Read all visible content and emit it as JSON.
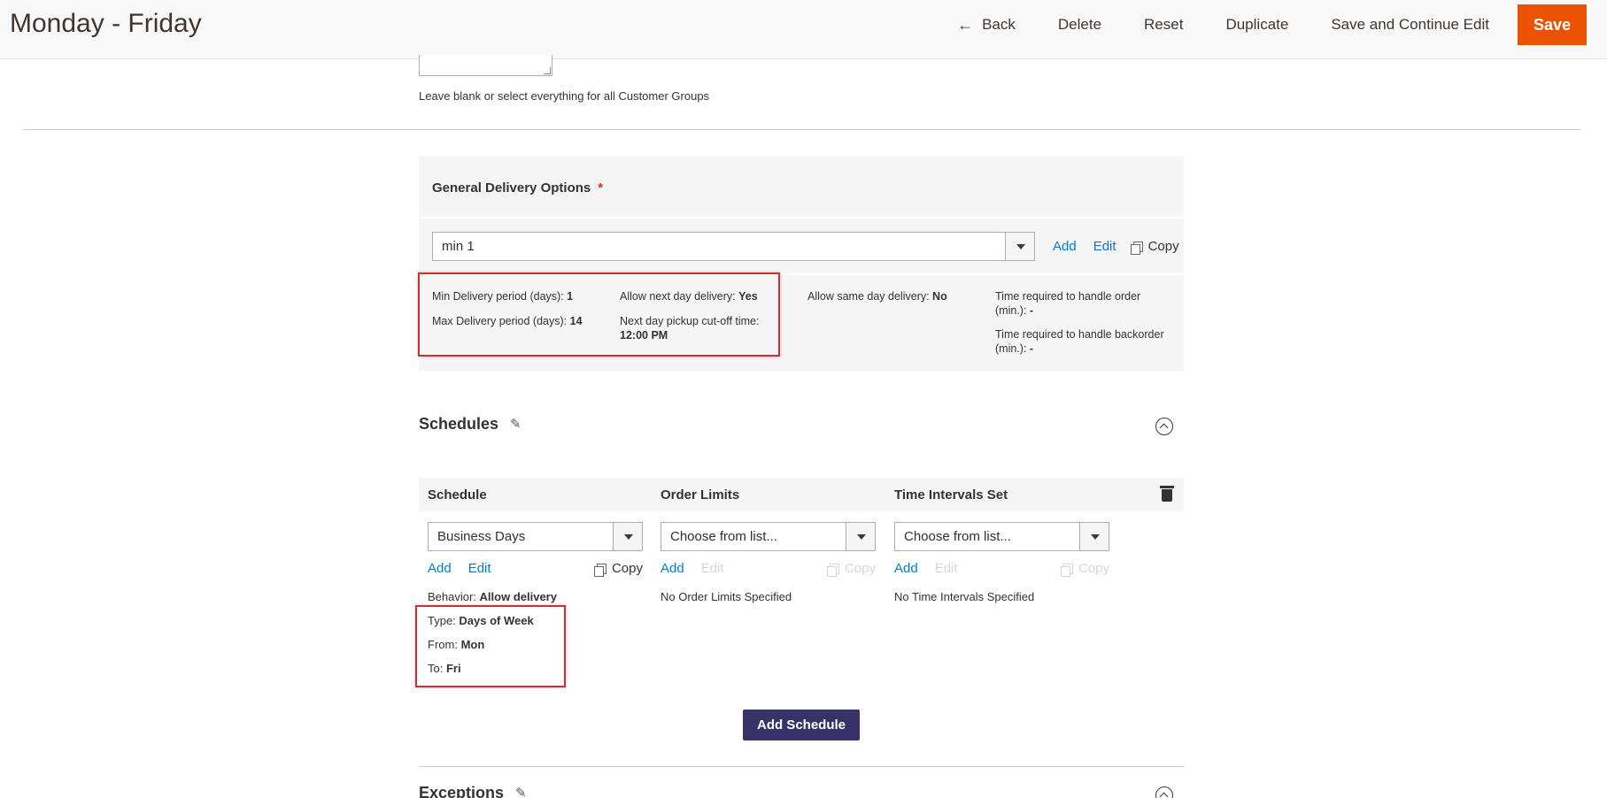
{
  "header": {
    "title": "Monday - Friday",
    "back_label": "Back",
    "delete_label": "Delete",
    "reset_label": "Reset",
    "duplicate_label": "Duplicate",
    "save_continue_label": "Save and Continue Edit",
    "save_label": "Save",
    "save_color": "#eb5202"
  },
  "customer_groups": {
    "note": "Leave blank or select everything for all Customer Groups"
  },
  "general_delivery": {
    "title": "General Delivery Options",
    "required_mark": "*",
    "selected": "min 1",
    "add_label": "Add",
    "edit_label": "Edit",
    "copy_label": "Copy",
    "info": {
      "min_label": "Min Delivery period (days):",
      "min_value": "1",
      "max_label": "Max Delivery period (days):",
      "max_value": "14",
      "next_day_label": "Allow next day delivery:",
      "next_day_value": "Yes",
      "cutoff_label": "Next day pickup cut-off time:",
      "cutoff_value": "12:00 PM",
      "same_day_label": "Allow same day delivery:",
      "same_day_value": "No",
      "handle_order_label": "Time required to handle order (min.):",
      "handle_order_value": "-",
      "handle_backorder_label": "Time required to handle backorder (min.):",
      "handle_backorder_value": "-"
    }
  },
  "schedules": {
    "title": "Schedules",
    "columns": {
      "schedule": "Schedule",
      "order_limits": "Order Limits",
      "time_intervals": "Time Intervals Set"
    },
    "schedule_select": "Business Days",
    "order_limits_select": "Choose from list...",
    "time_intervals_select": "Choose from list...",
    "add_label": "Add",
    "edit_label": "Edit",
    "copy_label": "Copy",
    "behavior_label": "Behavior:",
    "behavior_value": "Allow delivery",
    "type_label": "Type:",
    "type_value": "Days of Week",
    "from_label": "From:",
    "from_value": "Mon",
    "to_label": "To:",
    "to_value": "Fri",
    "no_limits": "No Order Limits Specified",
    "no_intervals": "No Time Intervals Specified",
    "add_schedule_label": "Add Schedule",
    "add_schedule_color": "#373368"
  },
  "exceptions": {
    "title": "Exceptions"
  },
  "highlight_color": "#d12f2f"
}
